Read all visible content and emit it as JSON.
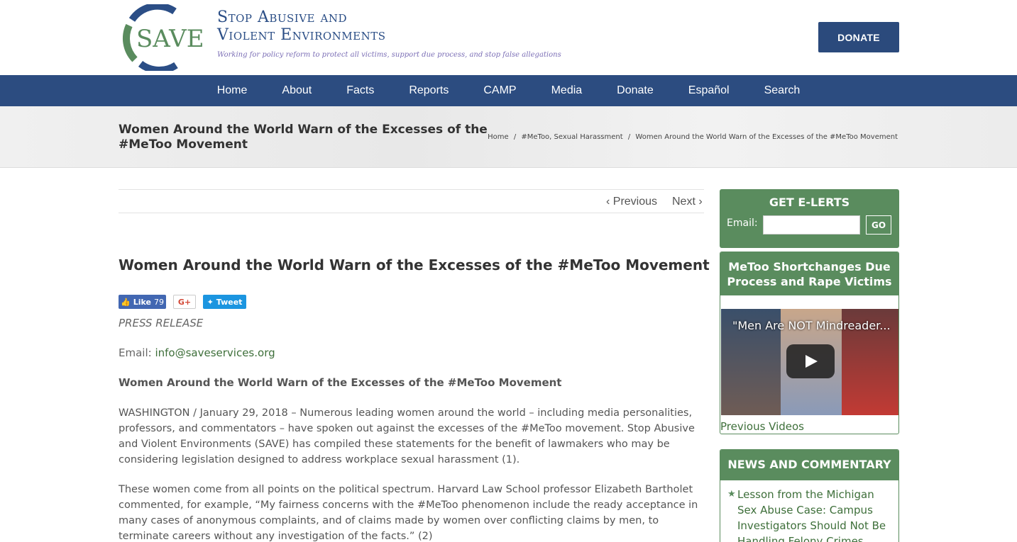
{
  "header": {
    "logo_text": "SAVE",
    "org_line1": "Stop Abusive and",
    "org_line2": "Violent Environments",
    "tagline": "Working for policy reform to protect all victims, support due process, and stop false allegations",
    "donate_label": "DONATE"
  },
  "nav": {
    "items": [
      "Home",
      "About",
      "Facts",
      "Reports",
      "CAMP",
      "Media",
      "Donate",
      "Español",
      "Search"
    ]
  },
  "titlebar": {
    "title": "Women Around the World Warn of the Excesses of the #MeToo Movement",
    "breadcrumb": [
      "Home",
      "#MeToo, Sexual Harassment",
      "Women Around the World Warn of the Excesses of the #MeToo Movement"
    ],
    "separator": "/"
  },
  "pager": {
    "previous": "Previous",
    "next": "Next"
  },
  "article": {
    "title": "Women Around the World Warn of the Excesses of the #MeToo Movement",
    "social": {
      "like": "Like",
      "like_count": "79",
      "gplus": "G+",
      "tweet": "Tweet"
    },
    "press": "PRESS RELEASE",
    "email_label": "Email:",
    "email": "info@saveservices.org",
    "subtitle": "Women Around the World Warn of the Excesses of the #MeToo Movement",
    "paragraphs": [
      "WASHINGTON / January 29, 2018 – Numerous leading women around the world – including media personalities, professors, and commentators – have spoken out against the excesses of the #MeToo movement. Stop Abusive and Violent Environments (SAVE) has compiled these statements for the benefit of lawmakers who may be considering legislation designed to address workplace sexual harassment (1).",
      "These women come from all points on the political spectrum. Harvard Law School professor Elizabeth Bartholet commented, for example, “My fairness concerns with the #MeToo phenomenon include the ready acceptance in many cases of anonymous complaints, and of claims made by women over conflicting claims by men, to terminate careers without any investigation of the facts.” (2)"
    ]
  },
  "sidebar": {
    "eletrts": {
      "title": "GET E-LERTS",
      "email_label": "Email:",
      "go": "GO"
    },
    "video_widget": {
      "title": "MeToo Shortchanges Due Process and Rape Victims",
      "video_title": "\"Men Are NOT Mindreader...",
      "previous_videos": "Previous Videos"
    },
    "news": {
      "title": "NEWS AND COMMENTARY",
      "items": [
        "Lesson from the Michigan Sex Abuse Case: Campus Investigators Should Not Be Handling Felony Crimes"
      ]
    }
  },
  "colors": {
    "navy": "#2c4c80",
    "green": "#5a8c5e",
    "link_green": "#3e6f3a"
  }
}
